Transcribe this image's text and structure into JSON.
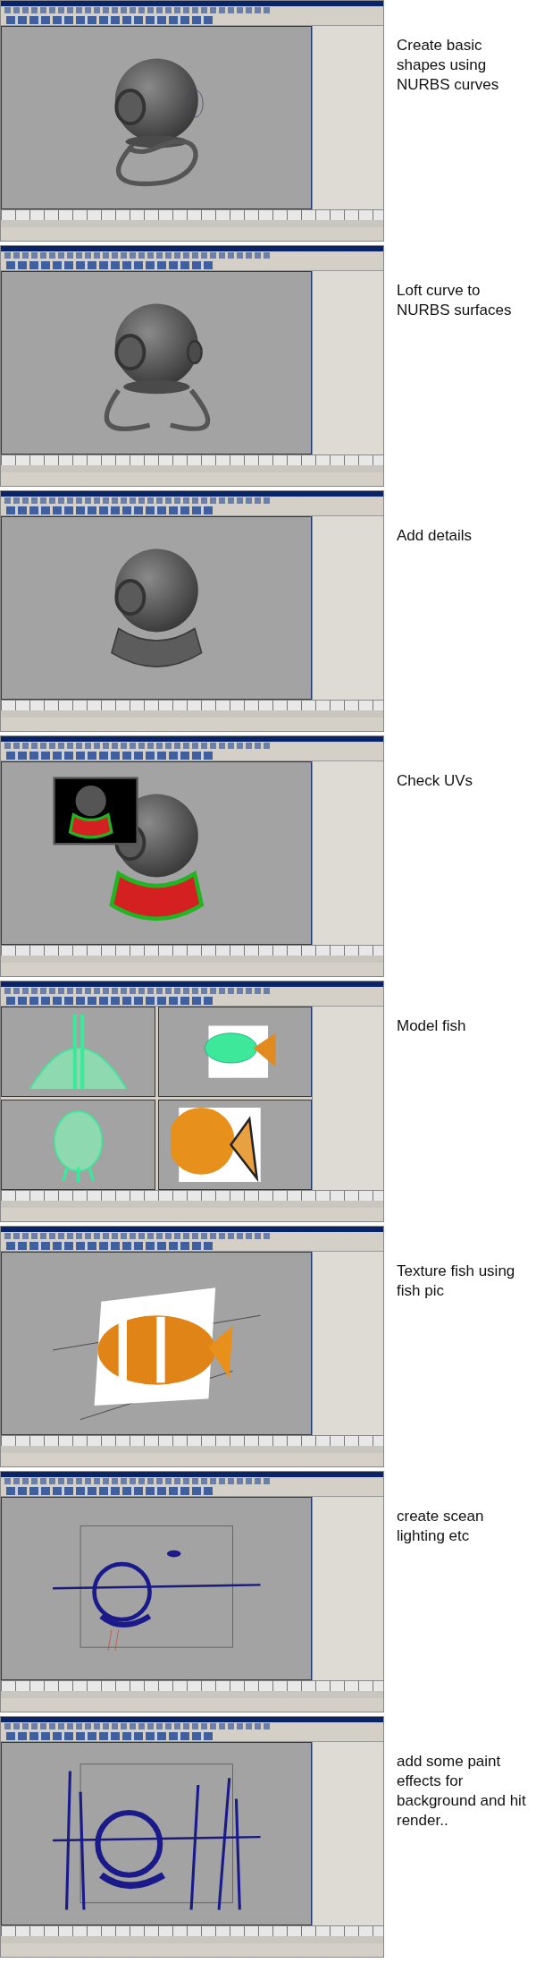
{
  "steps": [
    {
      "caption": "Create basic shapes using NURBS curves",
      "kind": "curves"
    },
    {
      "caption": "Loft curve to NURBS surfaces",
      "kind": "loft"
    },
    {
      "caption": "Add details",
      "kind": "details"
    },
    {
      "caption": "Check UVs",
      "kind": "uv"
    },
    {
      "caption": "Model fish",
      "kind": "quad"
    },
    {
      "caption": "Texture fish using fish pic",
      "kind": "texture"
    },
    {
      "caption": "create scean lighting etc",
      "kind": "lighting"
    },
    {
      "caption": "add some paint effects for background and hit render..",
      "kind": "paint"
    }
  ]
}
